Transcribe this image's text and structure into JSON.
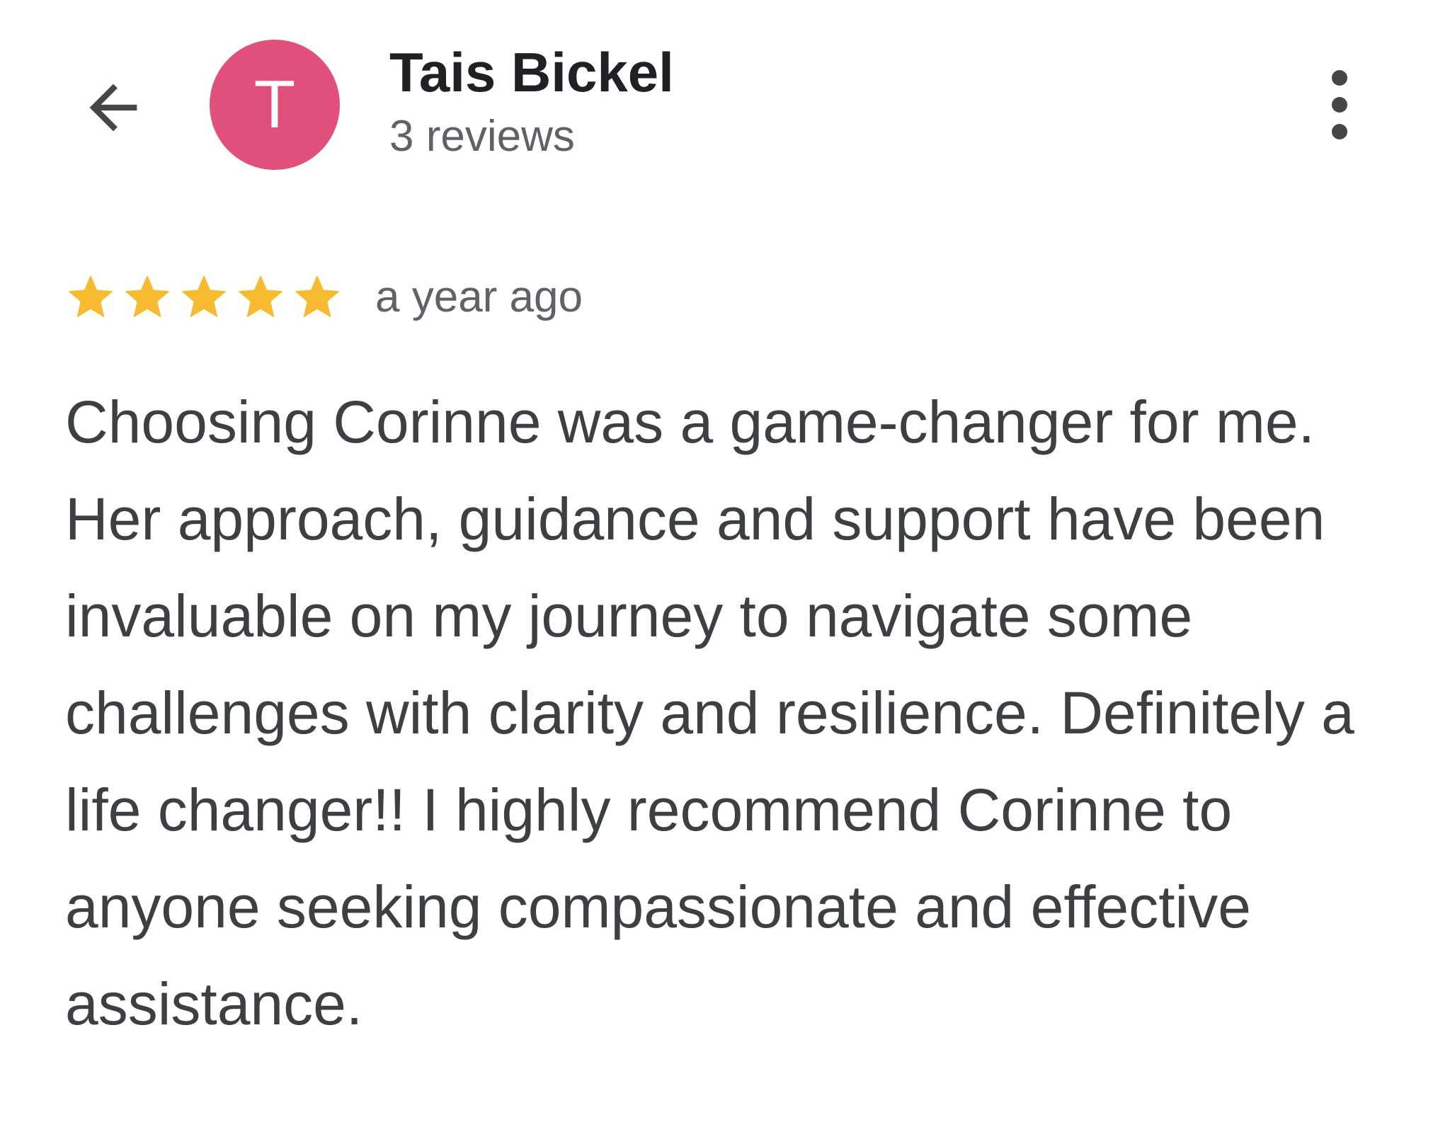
{
  "header": {
    "avatar_letter": "T",
    "user_name": "Tais Bickel",
    "review_count": "3 reviews",
    "icons": {
      "back": "arrow-left-icon",
      "more": "more-vertical-icon"
    }
  },
  "review": {
    "rating": 5,
    "max_rating": 5,
    "time": "a year ago",
    "text": "Choosing Corinne was a game-changer for me. Her approach, guidance and support have been invaluable on my journey to navigate some challenges with clarity and resilience. Definitely a life changer!! I highly recommend Corinne to anyone seeking compassionate and effective assistance."
  },
  "colors": {
    "avatar_bg": "#E0507A",
    "star": "#F6BB2E",
    "icon": "#444746"
  }
}
